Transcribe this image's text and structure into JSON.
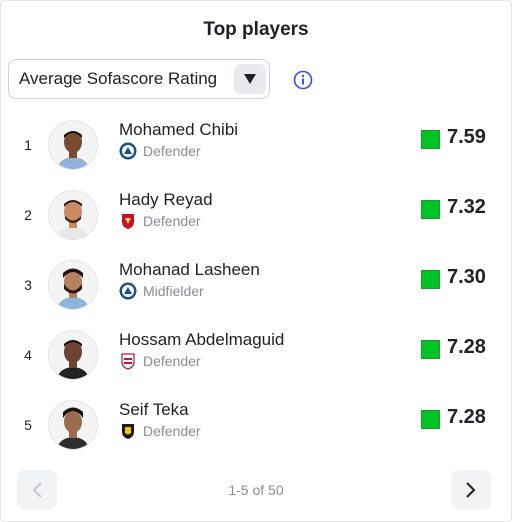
{
  "header": {
    "title": "Top players"
  },
  "filter": {
    "selected": "Average Sofascore Rating"
  },
  "players": [
    {
      "rank": "1",
      "name": "Mohamed Chibi",
      "role": "Defender",
      "rating": "7.59",
      "team_badge": "pyramids-badge"
    },
    {
      "rank": "2",
      "name": "Hady Reyad",
      "role": "Defender",
      "rating": "7.32",
      "team_badge": "al-ahly-badge"
    },
    {
      "rank": "3",
      "name": "Mohanad Lasheen",
      "role": "Midfielder",
      "rating": "7.30",
      "team_badge": "pyramids-badge"
    },
    {
      "rank": "4",
      "name": "Hossam Abdelmaguid",
      "role": "Defender",
      "rating": "7.28",
      "team_badge": "zamalek-badge"
    },
    {
      "rank": "5",
      "name": "Seif Teka",
      "role": "Defender",
      "rating": "7.28",
      "team_badge": "wadi-degla-badge"
    }
  ],
  "pagination": {
    "label": "1-5 of 50"
  },
  "colors": {
    "rating_green": "#00c424",
    "info_blue": "#374df5",
    "muted_text": "#8a8d95"
  }
}
